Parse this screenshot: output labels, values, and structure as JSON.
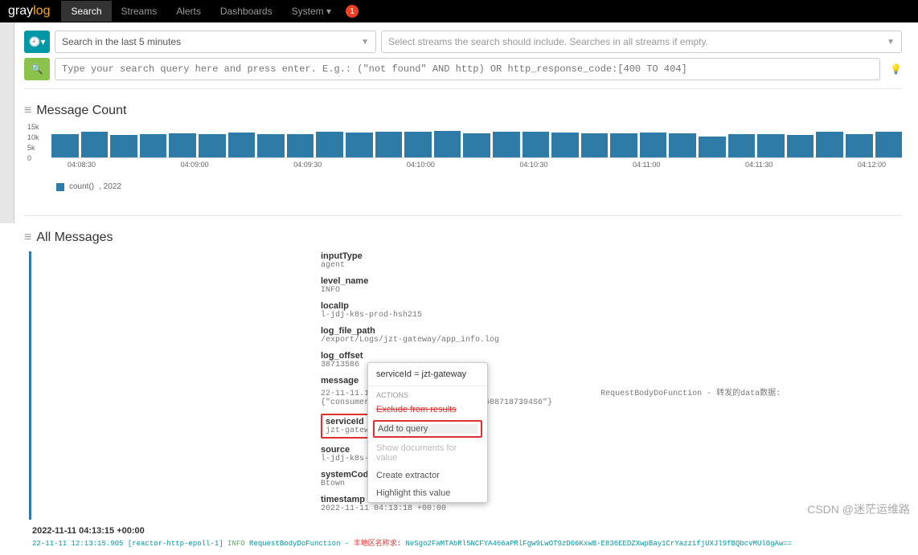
{
  "logo": {
    "part1": "gray",
    "part2": "log"
  },
  "nav": {
    "search": "Search",
    "streams": "Streams",
    "alerts": "Alerts",
    "dashboards": "Dashboards",
    "system": "System ▾",
    "notif": "1"
  },
  "search": {
    "time_range": "Search in the last 5 minutes",
    "stream_placeholder": "Select streams the search should include. Searches in all streams if empty.",
    "query_placeholder": "Type your search query here and press enter. E.g.: (\"not found\" AND http) OR http_response_code:[400 TO 404]"
  },
  "panels": {
    "message_count": "Message Count",
    "all_messages": "All Messages"
  },
  "chart_data": {
    "type": "bar",
    "categories": [
      "04:08:30",
      "04:09:00",
      "04:09:30",
      "04:10:00",
      "04:10:30",
      "04:11:00",
      "04:11:30",
      "04:12:00"
    ],
    "ytick": [
      "15k",
      "10k",
      "5k",
      "0"
    ],
    "values": [
      10000,
      11000,
      9500,
      10000,
      10200,
      9800,
      10500,
      10000,
      9800,
      10800,
      10500,
      11000,
      10800,
      11200,
      10200,
      10800,
      11000,
      10500,
      10200,
      10200,
      10500,
      10200,
      9000,
      10000,
      10000,
      9500,
      10800,
      9800,
      10800
    ],
    "ylim": [
      0,
      15000
    ],
    "legend": "count()",
    "legend_year": ", 2022"
  },
  "fields": {
    "inputType": {
      "name": "inputType",
      "value": "agent"
    },
    "level_name": {
      "name": "level_name",
      "value": "INFO"
    },
    "localIp": {
      "name": "localIp",
      "value": "l-jdj-k8s-prod-hsh215"
    },
    "log_file_path": {
      "name": "log_file_path",
      "value": "/export/Logs/jzt-gateway/app_info.log"
    },
    "log_offset": {
      "name": "log_offset",
      "value": "38713586"
    },
    "message": {
      "name": "message",
      "value": "22-11-11.12:1"
    },
    "message_tail": "RequestBodyDoFunction  - 转发的data数据: {\"consumerActivityId\":\"BA8818580115087187394S6\"}",
    "serviceId": {
      "name": "serviceId",
      "value": "jzt-gateway"
    },
    "source": {
      "name": "source",
      "value": "l-jdj-k8s-pro"
    },
    "systemCode": {
      "name": "systemCode",
      "value": "Btown"
    },
    "timestamp": {
      "name": "timestamp",
      "value": "2022-11-11 04:13:18 +00:00"
    }
  },
  "dropdown": {
    "header": "serviceId = jzt-gateway",
    "section": "ACTIONS",
    "exclude": "Exclude from results",
    "add_query": "Add to query",
    "show_docs": "Show documents for value",
    "create_extractor": "Create extractor",
    "highlight": "Highlight this value"
  },
  "bottom": {
    "timestamp": "2022-11-11 04:13:15 +00:00",
    "log_prefix": "22-11-11 12:13:15.905 [reactor-http-epoll-1]",
    "log_info": " INFO ",
    "log_mid": "RequestBodyDoFunction  - ",
    "log_red": "丰地区名称求:",
    "log_tail": " NeSgo2FaMTAbRl5NCFYA466aPRlFgw9LwOT9zD06KxwB-E836EEDZXwpBay1CrYazzifjUXJl9fBQbcvMUl0gAw=="
  },
  "watermark": "CSDN @迷茫运维路"
}
